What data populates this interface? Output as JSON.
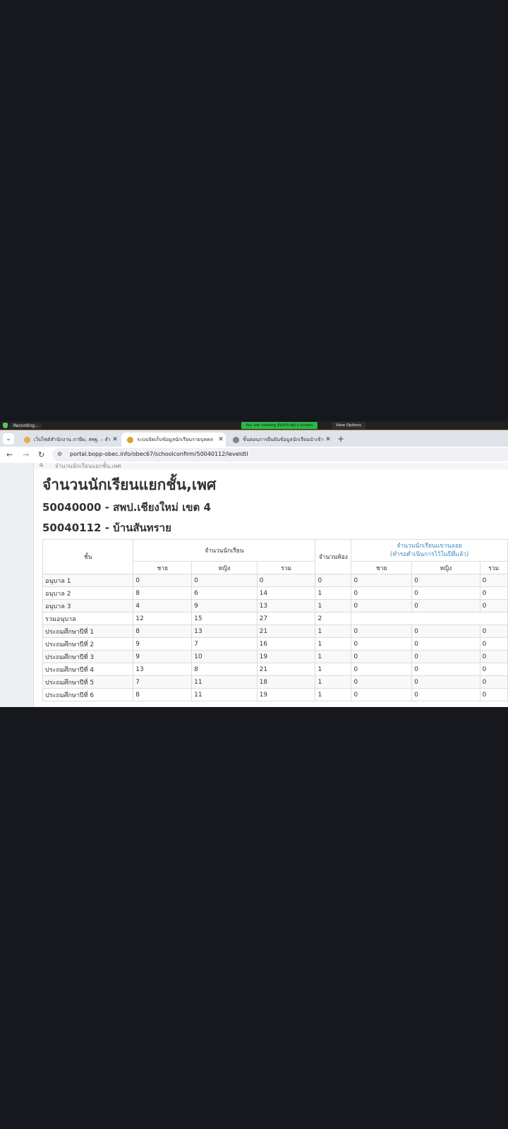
{
  "zoom_bar": {
    "recording": "Recording...",
    "share_notice": "You are viewing ห้องประชุม's screen",
    "view_options": "View Options"
  },
  "tabs": [
    {
      "title": "เว็บไซต์สำนักงาน ภาษีม. สพฐ. – สำนัก",
      "active": false
    },
    {
      "title": "ระบบจัดเก็บข้อมูลนักเรียนรายบุคคล",
      "active": true
    },
    {
      "title": "ขั้นตอนการยืนยันข้อมูลนักเรียนนำเข้า",
      "active": false
    }
  ],
  "address": {
    "url": "portal.bopp-obec.info/obec67/schoolconfirm/50040112/leveldtl"
  },
  "breadcrumb": "จำนวนนักเรียนแยกชั้น,เพศ",
  "page": {
    "title": "จำนวนนักเรียนแยกชั้น,เพศ",
    "area": "50040000 - สพป.เชียงใหม่ เขต 4",
    "school": "50040112 - บ้านสันทราย"
  },
  "table": {
    "h_level": "ชั้น",
    "h_students": "จำนวนนักเรียน",
    "h_rooms": "จำนวนห้อง",
    "h_extra_line1": "จำนวนนักเรียนแขวนลอย",
    "h_extra_line2": "(ทำรอดำเนินการไว้ในปีที่แล้ว)",
    "h_male": "ชาย",
    "h_female": "หญิง",
    "h_total": "รวม",
    "rows": [
      {
        "level": "อนุบาล 1",
        "male": "0",
        "female": "0",
        "total": "0",
        "rooms": "0",
        "x_male": "0",
        "x_female": "0",
        "x_total": "0"
      },
      {
        "level": "อนุบาล 2",
        "male": "8",
        "female": "6",
        "total": "14",
        "rooms": "1",
        "x_male": "0",
        "x_female": "0",
        "x_total": "0"
      },
      {
        "level": "อนุบาล 3",
        "male": "4",
        "female": "9",
        "total": "13",
        "rooms": "1",
        "x_male": "0",
        "x_female": "0",
        "x_total": "0"
      },
      {
        "level": "รวมอนุบาล",
        "male": "12",
        "female": "15",
        "total": "27",
        "rooms": "2",
        "x_male": "",
        "x_female": "",
        "x_total": ""
      },
      {
        "level": "ประถมศึกษาปีที่ 1",
        "male": "8",
        "female": "13",
        "total": "21",
        "rooms": "1",
        "x_male": "0",
        "x_female": "0",
        "x_total": "0"
      },
      {
        "level": "ประถมศึกษาปีที่ 2",
        "male": "9",
        "female": "7",
        "total": "16",
        "rooms": "1",
        "x_male": "0",
        "x_female": "0",
        "x_total": "0"
      },
      {
        "level": "ประถมศึกษาปีที่ 3",
        "male": "9",
        "female": "10",
        "total": "19",
        "rooms": "1",
        "x_male": "0",
        "x_female": "0",
        "x_total": "0"
      },
      {
        "level": "ประถมศึกษาปีที่ 4",
        "male": "13",
        "female": "8",
        "total": "21",
        "rooms": "1",
        "x_male": "0",
        "x_female": "0",
        "x_total": "0"
      },
      {
        "level": "ประถมศึกษาปีที่ 5",
        "male": "7",
        "female": "11",
        "total": "18",
        "rooms": "1",
        "x_male": "0",
        "x_female": "0",
        "x_total": "0"
      },
      {
        "level": "ประถมศึกษาปีที่ 6",
        "male": "8",
        "female": "11",
        "total": "19",
        "rooms": "1",
        "x_male": "0",
        "x_female": "0",
        "x_total": "0"
      }
    ]
  }
}
